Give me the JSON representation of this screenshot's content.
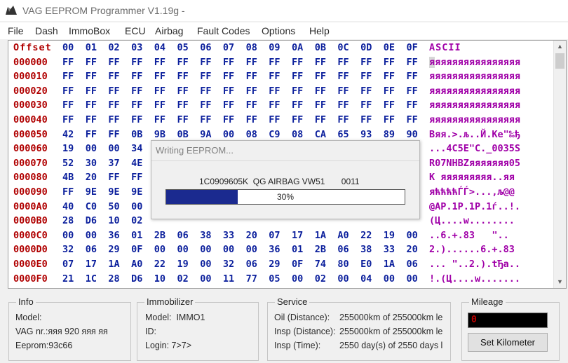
{
  "window": {
    "title": "VAG EEPROM Programmer  V1.19g -"
  },
  "menu": [
    "File",
    "Dash",
    "ImmoBox",
    "ECU",
    "Airbag",
    "Fault Codes",
    "Options",
    "Help"
  ],
  "hex": {
    "header": {
      "offset": "Offset",
      "cols": [
        "00",
        "01",
        "02",
        "03",
        "04",
        "05",
        "06",
        "07",
        "08",
        "09",
        "0A",
        "0B",
        "0C",
        "0D",
        "0E",
        "0F"
      ],
      "ascii": "ASCII"
    },
    "rows": [
      {
        "offset": "000000",
        "bytes": [
          "FF",
          "FF",
          "FF",
          "FF",
          "FF",
          "FF",
          "FF",
          "FF",
          "FF",
          "FF",
          "FF",
          "FF",
          "FF",
          "FF",
          "FF",
          "FF"
        ],
        "ascii": "яяяяяяяяяяяяяяяя"
      },
      {
        "offset": "000010",
        "bytes": [
          "FF",
          "FF",
          "FF",
          "FF",
          "FF",
          "FF",
          "FF",
          "FF",
          "FF",
          "FF",
          "FF",
          "FF",
          "FF",
          "FF",
          "FF",
          "FF"
        ],
        "ascii": "яяяяяяяяяяяяяяяя"
      },
      {
        "offset": "000020",
        "bytes": [
          "FF",
          "FF",
          "FF",
          "FF",
          "FF",
          "FF",
          "FF",
          "FF",
          "FF",
          "FF",
          "FF",
          "FF",
          "FF",
          "FF",
          "FF",
          "FF"
        ],
        "ascii": "яяяяяяяяяяяяяяяя"
      },
      {
        "offset": "000030",
        "bytes": [
          "FF",
          "FF",
          "FF",
          "FF",
          "FF",
          "FF",
          "FF",
          "FF",
          "FF",
          "FF",
          "FF",
          "FF",
          "FF",
          "FF",
          "FF",
          "FF"
        ],
        "ascii": "яяяяяяяяяяяяяяяя"
      },
      {
        "offset": "000040",
        "bytes": [
          "FF",
          "FF",
          "FF",
          "FF",
          "FF",
          "FF",
          "FF",
          "FF",
          "FF",
          "FF",
          "FF",
          "FF",
          "FF",
          "FF",
          "FF",
          "FF"
        ],
        "ascii": "яяяяяяяяяяяяяяяя"
      },
      {
        "offset": "000050",
        "bytes": [
          "42",
          "FF",
          "FF",
          "0B",
          "9B",
          "0B",
          "9A",
          "00",
          "08",
          "C9",
          "08",
          "CA",
          "65",
          "93",
          "89",
          "90"
        ],
        "ascii": "Bяя.>.љ..Й.Ke\"‰ђ"
      },
      {
        "offset": "000060",
        "bytes": [
          "19",
          "00",
          "00",
          "34",
          "",
          "",
          "",
          "",
          "",
          "",
          "",
          "",
          "",
          "",
          "",
          ""
        ],
        "ascii": "...4C5E\"C._0035S"
      },
      {
        "offset": "000070",
        "bytes": [
          "52",
          "30",
          "37",
          "4E",
          "",
          "",
          "",
          "",
          "",
          "",
          "",
          "",
          "",
          "",
          "",
          ""
        ],
        "ascii": "R07NHBZяяяяяяя05"
      },
      {
        "offset": "000080",
        "bytes": [
          "4B",
          "20",
          "FF",
          "FF",
          "",
          "",
          "",
          "",
          "",
          "",
          "",
          "",
          "",
          "",
          "",
          ""
        ],
        "ascii": "K яяяяяяяяя..яя"
      },
      {
        "offset": "000090",
        "bytes": [
          "FF",
          "9E",
          "9E",
          "9E",
          "",
          "",
          "",
          "",
          "",
          "",
          "",
          "",
          "",
          "",
          "",
          ""
        ],
        "ascii": "яћћћћЃЃ>...,љ@@"
      },
      {
        "offset": "0000A0",
        "bytes": [
          "40",
          "C0",
          "50",
          "00",
          "",
          "",
          "",
          "",
          "",
          "",
          "",
          "",
          "",
          "",
          "",
          ""
        ],
        "ascii": "@AP.1P.1P.1ѓ..!."
      },
      {
        "offset": "0000B0",
        "bytes": [
          "28",
          "D6",
          "10",
          "02",
          "",
          "",
          "",
          "",
          "",
          "",
          "",
          "",
          "",
          "",
          "",
          ""
        ],
        "ascii": "(Ц....w........"
      },
      {
        "offset": "0000C0",
        "bytes": [
          "00",
          "00",
          "36",
          "01",
          "2B",
          "06",
          "38",
          "33",
          "20",
          "07",
          "17",
          "1A",
          "A0",
          "22",
          "19",
          "00"
        ],
        "ascii": "..6.+.83   \".."
      },
      {
        "offset": "0000D0",
        "bytes": [
          "32",
          "06",
          "29",
          "0F",
          "00",
          "00",
          "00",
          "00",
          "00",
          "36",
          "01",
          "2B",
          "06",
          "38",
          "33",
          "20"
        ],
        "ascii": "2.)......6.+.83 "
      },
      {
        "offset": "0000E0",
        "bytes": [
          "07",
          "17",
          "1A",
          "A0",
          "22",
          "19",
          "00",
          "32",
          "06",
          "29",
          "0F",
          "74",
          "80",
          "E0",
          "1A",
          "06"
        ],
        "ascii": "... \"..2.).tЂа.."
      },
      {
        "offset": "0000F0",
        "bytes": [
          "21",
          "1C",
          "28",
          "D6",
          "10",
          "02",
          "00",
          "11",
          "77",
          "05",
          "00",
          "02",
          "00",
          "04",
          "00",
          "00"
        ],
        "ascii": "!.(Ц....w......."
      }
    ]
  },
  "dialog": {
    "title": "Writing EEPROM...",
    "part": "1C0909605K  QG AIRBAG VW51       0011",
    "progress_label": "30%",
    "progress": 0.3
  },
  "info": {
    "title": "Info",
    "model": "Model:",
    "vag": "VAG nr.:яяя 920 яяя яя",
    "eeprom": "Eeprom:93c66"
  },
  "immobilizer": {
    "title": "Immobilizer",
    "model": "Model:  IMMO1",
    "id": "ID:",
    "login": "Login: 7>7>"
  },
  "service": {
    "title": "Service",
    "oil_label": "Oil (Distance):",
    "oil_value": "255000km of 255000km le",
    "insp_d_label": "Insp (Distance):",
    "insp_d_value": "255000km of 255000km le",
    "insp_t_label": "Insp (Time):",
    "insp_t_value": "2550 day(s) of 2550 days l"
  },
  "mileage": {
    "title": "Mileage",
    "value": "0",
    "button": "Set Kilometer"
  },
  "colors": {
    "offset": "#b00000",
    "hex": "#0b1f9c",
    "ascii": "#a000a8",
    "progress": "#1b2a8f"
  }
}
